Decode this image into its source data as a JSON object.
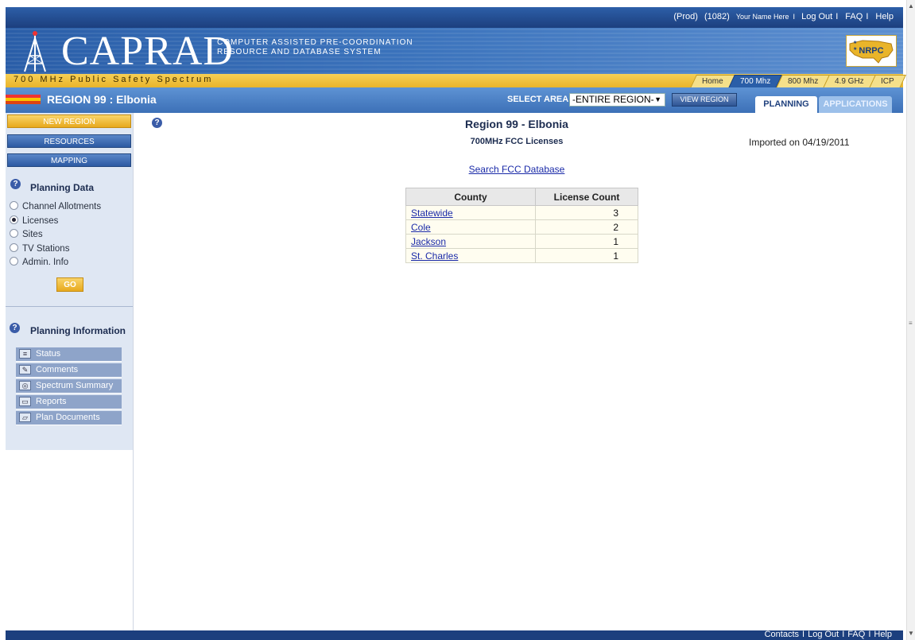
{
  "top": {
    "env": "(Prod)",
    "user_id": "(1082)",
    "user_name": "Your Name Here",
    "sep": "I",
    "logout": "Log Out",
    "faq": "FAQ",
    "help": "Help"
  },
  "banner": {
    "logo": "CAPRAD",
    "subtitle_line1": "COMPUTER ASSISTED PRE-COORDINATION",
    "subtitle_line2": "RESOURCE AND DATABASE SYSTEM",
    "badge": "NRPC"
  },
  "band": {
    "spectrum": "700 MHz Public Safety Spectrum",
    "tabs": [
      "Home",
      "700 Mhz",
      "800 Mhz",
      "4.9 GHz",
      "ICP"
    ],
    "active_tab": "700 Mhz"
  },
  "region": {
    "title": "REGION 99 : Elbonia",
    "select_label": "SELECT AREA:",
    "select_value": "-ENTIRE REGION-",
    "view_button": "VIEW REGION",
    "tab_planning": "PLANNING",
    "tab_applications": "APPLICATIONS"
  },
  "sidebar": {
    "buttons": [
      "NEW REGION",
      "RESOURCES",
      "MAPPING"
    ],
    "planning_data_title": "Planning Data",
    "options": [
      "Channel Allotments",
      "Licenses",
      "Sites",
      "TV Stations",
      "Admin. Info"
    ],
    "selected_option": "Licenses",
    "go": "GO",
    "planning_info_title": "Planning Information",
    "info_items": [
      "Status",
      "Comments",
      "Spectrum Summary",
      "Reports",
      "Plan Documents"
    ]
  },
  "main": {
    "title": "Region 99 - Elbonia",
    "subtitle": "700MHz FCC Licenses",
    "imported": "Imported on 04/19/2011",
    "search_link": "Search FCC Database",
    "table": {
      "headers": [
        "County",
        "License Count"
      ],
      "rows": [
        {
          "county": "Statewide",
          "count": "3"
        },
        {
          "county": "Cole",
          "count": "2"
        },
        {
          "county": "Jackson",
          "count": "1"
        },
        {
          "county": "St. Charles",
          "count": "1"
        }
      ]
    }
  },
  "footer": {
    "contacts": "Contacts",
    "logout": "Log Out",
    "faq": "FAQ",
    "help": "Help",
    "sep": "I"
  },
  "colors": {
    "header_blue": "#1c3f7e",
    "band_yellow": "#f0c23c",
    "region_blue": "#4a80c4"
  }
}
